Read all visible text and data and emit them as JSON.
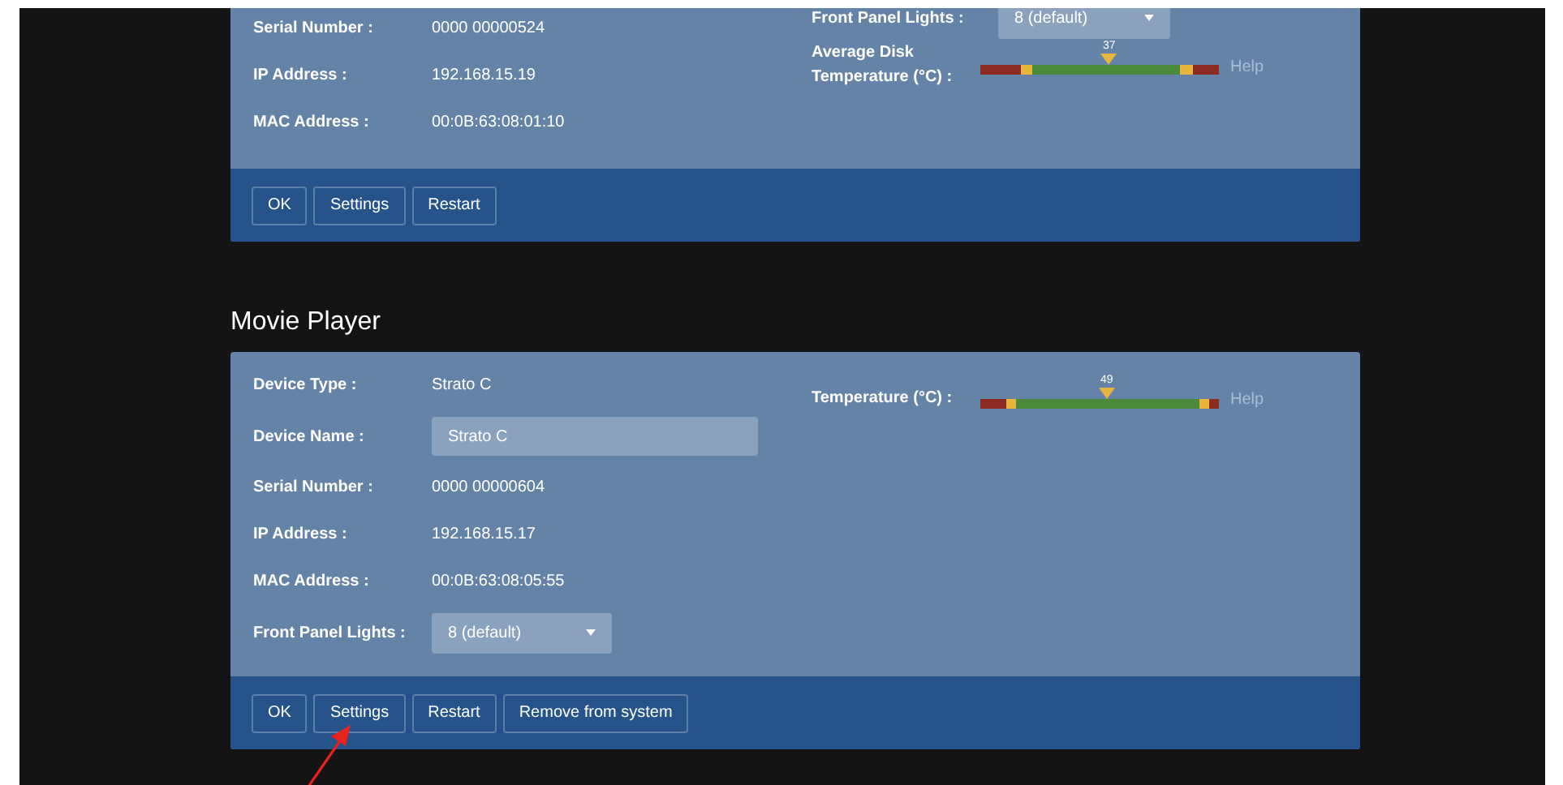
{
  "panels": [
    {
      "left": [
        {
          "kind": "text",
          "label": "Serial Number :",
          "value": "0000 00000524"
        },
        {
          "kind": "text",
          "label": "IP Address :",
          "value": "192.168.15.19"
        },
        {
          "kind": "text",
          "label": "MAC Address :",
          "value": "00:0B:63:08:01:10"
        }
      ],
      "right": [
        {
          "kind": "select",
          "label": "Front Panel Lights :",
          "value": "8 (default)"
        },
        {
          "kind": "meter",
          "label": "Average Disk Temperature (°C) :",
          "reading": "37",
          "level": 0.54,
          "help": "Help"
        }
      ],
      "buttons": [
        "OK",
        "Settings",
        "Restart"
      ]
    },
    {
      "title": "Movie Player",
      "left": [
        {
          "kind": "text",
          "label": "Device Type :",
          "value": "Strato C"
        },
        {
          "kind": "input",
          "label": "Device Name :",
          "value": "Strato C"
        },
        {
          "kind": "text",
          "label": "Serial Number :",
          "value": "0000 00000604"
        },
        {
          "kind": "text",
          "label": "IP Address :",
          "value": "192.168.15.17"
        },
        {
          "kind": "text",
          "label": "MAC Address :",
          "value": "00:0B:63:08:05:55"
        },
        {
          "kind": "select",
          "label": "Front Panel Lights :",
          "value": "8 (default)"
        }
      ],
      "right": [
        {
          "kind": "meter",
          "label": "Temperature (°C) :",
          "reading": "49",
          "level": 0.53,
          "help": "Help"
        }
      ],
      "buttons": [
        "OK",
        "Settings",
        "Restart",
        "Remove from system"
      ]
    }
  ]
}
